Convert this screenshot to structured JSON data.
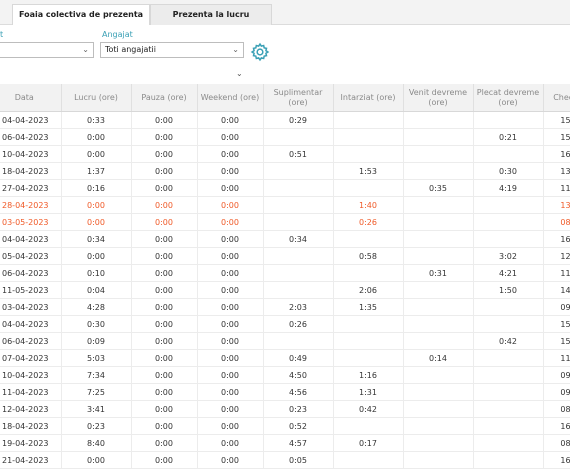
{
  "tabs": [
    "Foaia colectiva de prezenta",
    "Prezenta la lucru"
  ],
  "filters": {
    "left_label": "t",
    "employee_label": "Angajat",
    "employee_value": "Toti angajatii"
  },
  "columns": [
    "Data",
    "Lucru (ore)",
    "Pauza (ore)",
    "Weekend (ore)",
    "Suplimentar (ore)",
    "Intarziat (ore)",
    "Venit devreme (ore)",
    "Plecat devreme (ore)",
    "Check"
  ],
  "rows": [
    {
      "date": "04-04-2023",
      "lucru": "0:33",
      "pauza": "0:00",
      "weekend": "0:00",
      "supl": "0:29",
      "intarziat": "",
      "venit": "",
      "plecat": "",
      "check": "15"
    },
    {
      "date": "06-04-2023",
      "lucru": "0:00",
      "pauza": "0:00",
      "weekend": "0:00",
      "supl": "",
      "intarziat": "",
      "venit": "",
      "plecat": "0:21",
      "check": "15"
    },
    {
      "date": "10-04-2023",
      "lucru": "0:00",
      "pauza": "0:00",
      "weekend": "0:00",
      "supl": "0:51",
      "intarziat": "",
      "venit": "",
      "plecat": "",
      "check": "16"
    },
    {
      "date": "18-04-2023",
      "lucru": "1:37",
      "pauza": "0:00",
      "weekend": "0:00",
      "supl": "",
      "intarziat": "1:53",
      "venit": "",
      "plecat": "0:30",
      "check": "13"
    },
    {
      "date": "27-04-2023",
      "lucru": "0:16",
      "pauza": "0:00",
      "weekend": "0:00",
      "supl": "",
      "intarziat": "",
      "venit": "0:35",
      "plecat": "4:19",
      "check": "11"
    },
    {
      "date": "28-04-2023",
      "lucru": "0:00",
      "pauza": "0:00",
      "weekend": "0:00",
      "supl": "",
      "intarziat": "1:40",
      "venit": "",
      "plecat": "",
      "check": "13",
      "red": true
    },
    {
      "date": "03-05-2023",
      "lucru": "0:00",
      "pauza": "0:00",
      "weekend": "0:00",
      "supl": "",
      "intarziat": "0:26",
      "venit": "",
      "plecat": "",
      "check": "08",
      "red": true
    },
    {
      "date": "04-04-2023",
      "lucru": "0:34",
      "pauza": "0:00",
      "weekend": "0:00",
      "supl": "0:34",
      "intarziat": "",
      "venit": "",
      "plecat": "",
      "check": "16"
    },
    {
      "date": "05-04-2023",
      "lucru": "0:00",
      "pauza": "0:00",
      "weekend": "0:00",
      "supl": "",
      "intarziat": "0:58",
      "venit": "",
      "plecat": "3:02",
      "check": "12"
    },
    {
      "date": "06-04-2023",
      "lucru": "0:10",
      "pauza": "0:00",
      "weekend": "0:00",
      "supl": "",
      "intarziat": "",
      "venit": "0:31",
      "plecat": "4:21",
      "check": "11"
    },
    {
      "date": "11-05-2023",
      "lucru": "0:04",
      "pauza": "0:00",
      "weekend": "0:00",
      "supl": "",
      "intarziat": "2:06",
      "venit": "",
      "plecat": "1:50",
      "check": "14"
    },
    {
      "date": "03-04-2023",
      "lucru": "4:28",
      "pauza": "0:00",
      "weekend": "0:00",
      "supl": "2:03",
      "intarziat": "1:35",
      "venit": "",
      "plecat": "",
      "check": "09"
    },
    {
      "date": "04-04-2023",
      "lucru": "0:30",
      "pauza": "0:00",
      "weekend": "0:00",
      "supl": "0:26",
      "intarziat": "",
      "venit": "",
      "plecat": "",
      "check": "15"
    },
    {
      "date": "06-04-2023",
      "lucru": "0:09",
      "pauza": "0:00",
      "weekend": "0:00",
      "supl": "",
      "intarziat": "",
      "venit": "",
      "plecat": "0:42",
      "check": "15"
    },
    {
      "date": "07-04-2023",
      "lucru": "5:03",
      "pauza": "0:00",
      "weekend": "0:00",
      "supl": "0:49",
      "intarziat": "",
      "venit": "0:14",
      "plecat": "",
      "check": "11"
    },
    {
      "date": "10-04-2023",
      "lucru": "7:34",
      "pauza": "0:00",
      "weekend": "0:00",
      "supl": "4:50",
      "intarziat": "1:16",
      "venit": "",
      "plecat": "",
      "check": "09"
    },
    {
      "date": "11-04-2023",
      "lucru": "7:25",
      "pauza": "0:00",
      "weekend": "0:00",
      "supl": "4:56",
      "intarziat": "1:31",
      "venit": "",
      "plecat": "",
      "check": "09"
    },
    {
      "date": "12-04-2023",
      "lucru": "3:41",
      "pauza": "0:00",
      "weekend": "0:00",
      "supl": "0:23",
      "intarziat": "0:42",
      "venit": "",
      "plecat": "",
      "check": "08"
    },
    {
      "date": "18-04-2023",
      "lucru": "0:23",
      "pauza": "0:00",
      "weekend": "0:00",
      "supl": "0:52",
      "intarziat": "",
      "venit": "",
      "plecat": "",
      "check": "16"
    },
    {
      "date": "19-04-2023",
      "lucru": "8:40",
      "pauza": "0:00",
      "weekend": "0:00",
      "supl": "4:57",
      "intarziat": "0:17",
      "venit": "",
      "plecat": "",
      "check": "08"
    },
    {
      "date": "21-04-2023",
      "lucru": "0:00",
      "pauza": "0:00",
      "weekend": "0:00",
      "supl": "0:05",
      "intarziat": "",
      "venit": "",
      "plecat": "",
      "check": "16"
    }
  ],
  "colors": {
    "accent": "#3aa0b5",
    "late_row": "#f05a28"
  },
  "icons": {
    "settings": "gear-icon",
    "collapse": "chevron-down-icon"
  }
}
